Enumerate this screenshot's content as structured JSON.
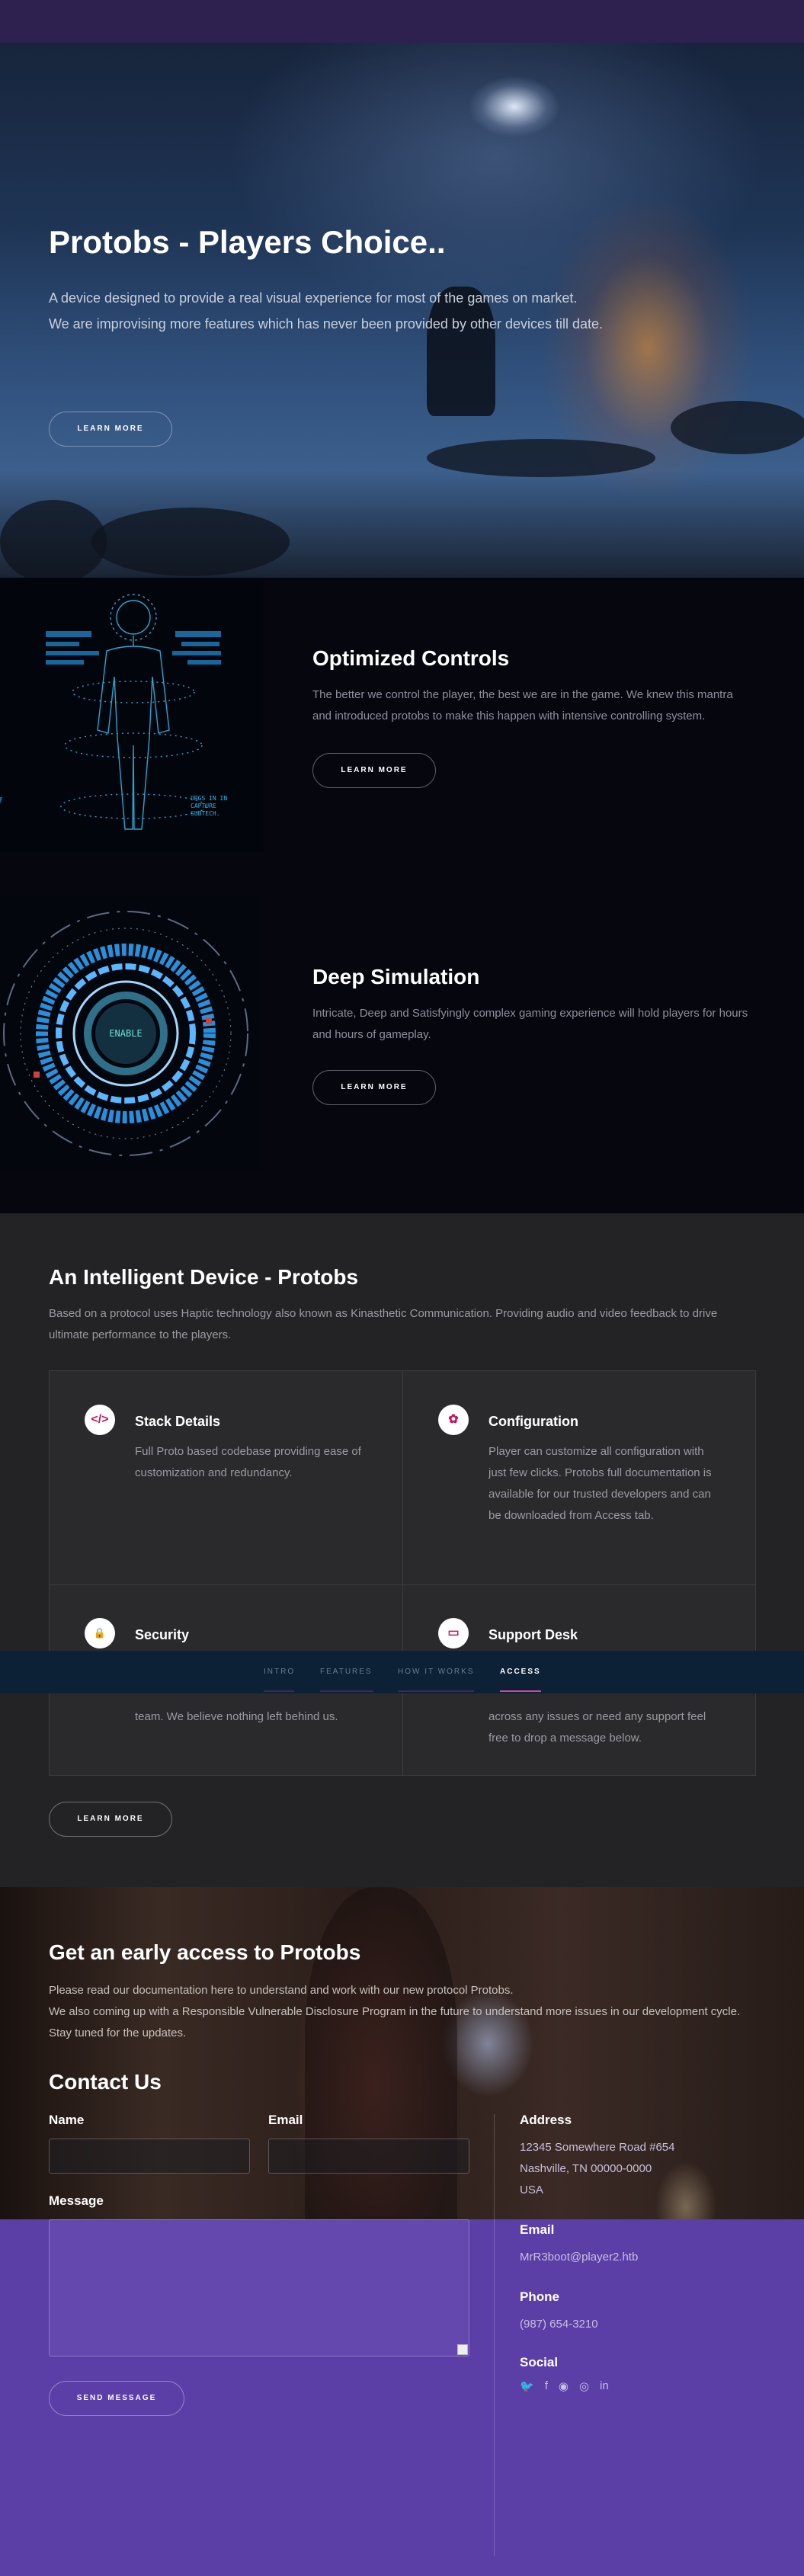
{
  "hero": {
    "title": "Protobs - Players Choice..",
    "line1": "A device designed to provide a real visual experience for most of the games on market.",
    "line2": "We are improvising more features which has never been provided by other devices till date.",
    "button": "LEARN MORE"
  },
  "features": [
    {
      "title": "Optimized Controls",
      "desc": "The better we control the player, the best we are in the game. We knew this mantra and introduced protobs to make this happen with intensive controlling system.",
      "button": "LEARN MORE",
      "image_caption": "ORGS IN IN\nCAPTURE\nSUBTECH."
    },
    {
      "title": "Deep Simulation",
      "desc": "Intricate, Deep and Satisfyingly complex gaming experience will hold players for hours and hours of gameplay.",
      "button": "LEARN MORE",
      "image_caption": "ENABLE"
    }
  ],
  "device": {
    "title": "An Intelligent Device - Protobs",
    "desc": "Based on a protocol uses Haptic technology also known as Kinasthetic Communication. Providing audio and video feedback to drive ultimate performance to the players.",
    "cells": [
      {
        "icon": "code-icon",
        "glyph": "</>",
        "title": "Stack Details",
        "desc": "Full Proto based codebase providing ease of customization and redundancy."
      },
      {
        "icon": "gear-icon",
        "glyph": "✿",
        "title": "Configuration",
        "desc": "Player can customize all configuration with just few clicks. Protobs full documentation is available for our trusted developers and can be downloaded from Access tab."
      },
      {
        "icon": "lock-icon",
        "glyph": "🔒",
        "title": "Security",
        "desc": "team. We believe nothing left behind us."
      },
      {
        "icon": "monitor-icon",
        "glyph": "▭",
        "title": "Support Desk",
        "desc": "across any issues or need any support feel free to drop a message below."
      }
    ],
    "button": "LEARN MORE"
  },
  "nav": {
    "items": [
      {
        "label": "INTRO",
        "active": false
      },
      {
        "label": "FEATURES",
        "active": false
      },
      {
        "label": "HOW IT WORKS",
        "active": false
      },
      {
        "label": "ACCESS",
        "active": true
      }
    ],
    "accent": "#e0449a"
  },
  "access": {
    "title": "Get an early access to Protobs",
    "line1": "Please read our documentation here to understand and work with our new protocol Protobs.",
    "line2": "We also coming up with a Responsible Vulnerable Disclosure Program in the future to understand more issues in our development cycle. Stay tuned for the updates."
  },
  "contact": {
    "title": "Contact Us",
    "name_label": "Name",
    "email_label": "Email",
    "message_label": "Message",
    "send_button": "SEND MESSAGE",
    "address_title": "Address",
    "address_line1": "12345 Somewhere Road #654",
    "address_line2": "Nashville, TN 00000-0000",
    "address_line3": "USA",
    "email_title": "Email",
    "email_value": "MrR3boot@player2.htb",
    "phone_title": "Phone",
    "phone_value": "(987) 654-3210",
    "social_title": "Social",
    "social_icons": [
      "twitter-icon",
      "facebook-icon",
      "github-icon",
      "instagram-icon",
      "linkedin-icon"
    ]
  },
  "colors": {
    "brand_purple": "#5b3fa6",
    "icon_accent": "#c2185b",
    "nav_bg": "#0c2136"
  }
}
